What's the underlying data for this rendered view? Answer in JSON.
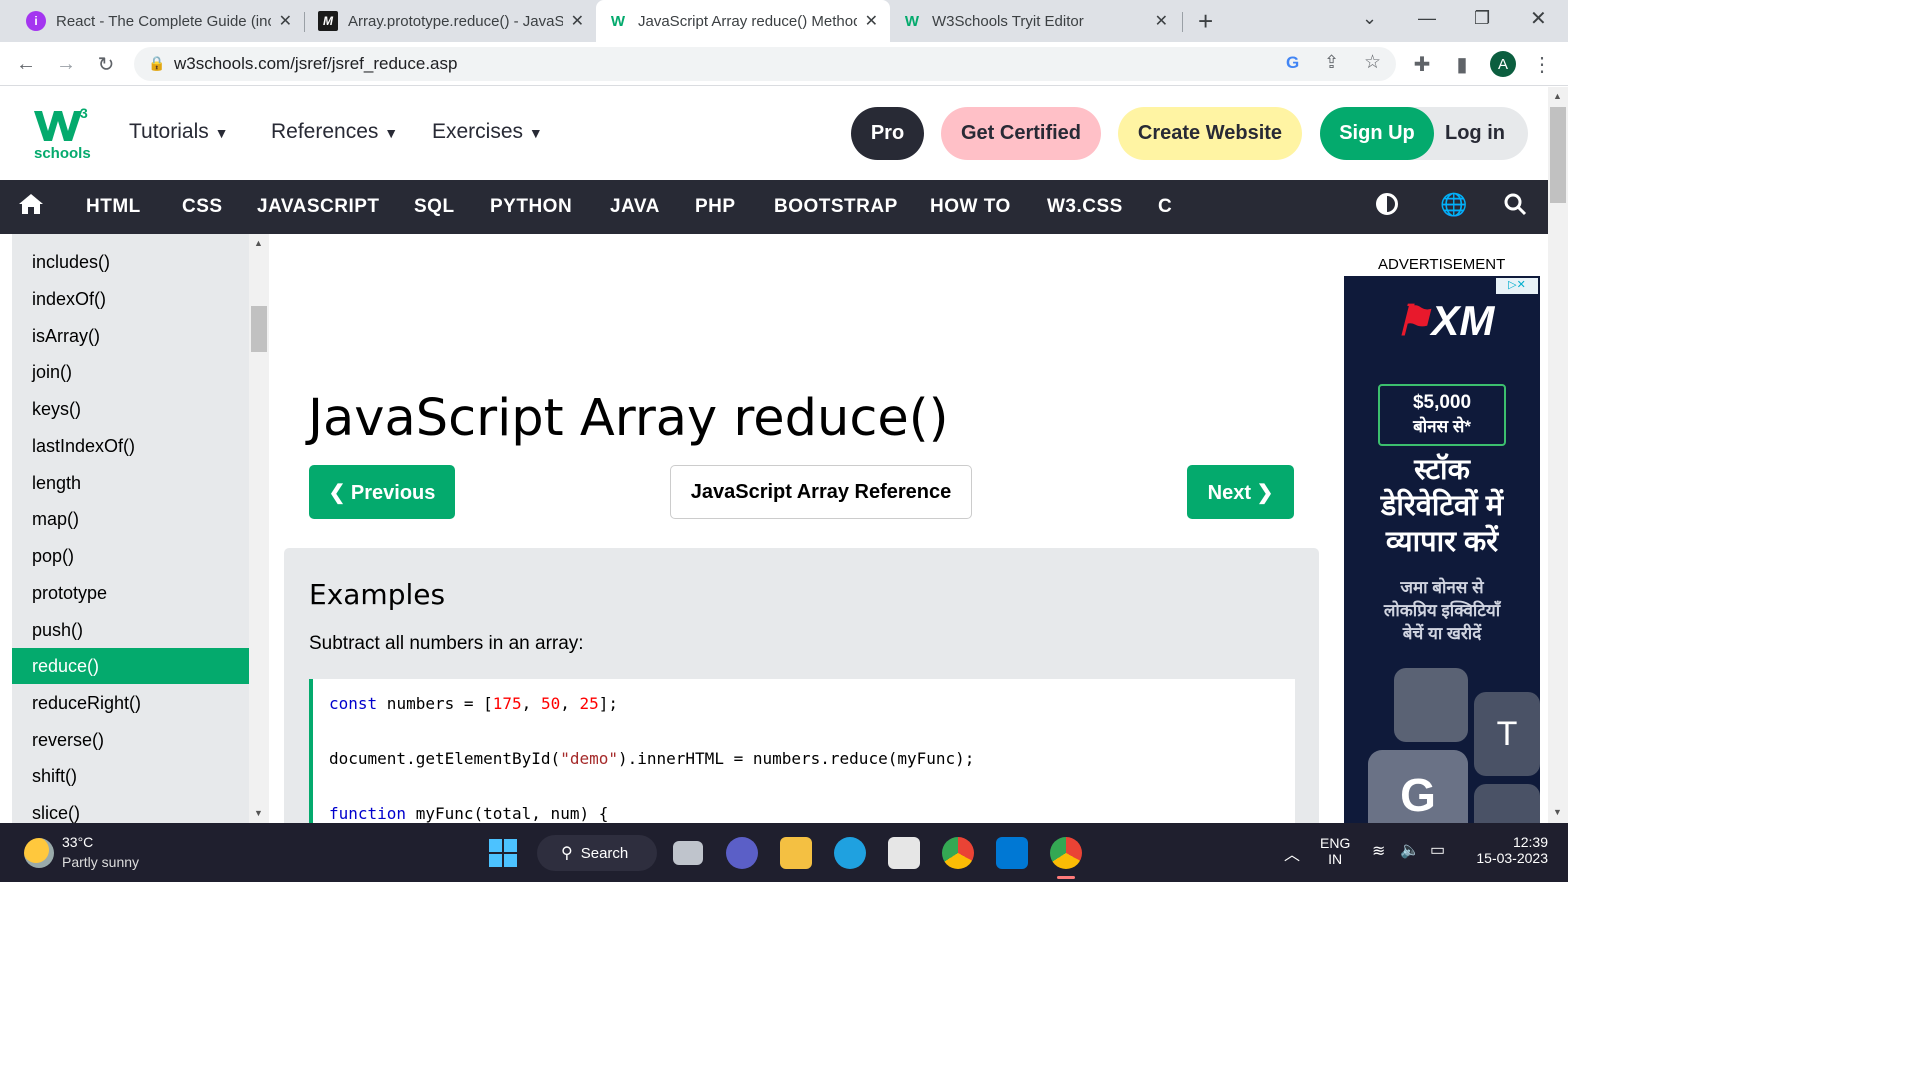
{
  "browser": {
    "tabs": [
      {
        "title": "React - The Complete Guide (incl",
        "icon": "udemy-icon",
        "color": "#a435f0"
      },
      {
        "title": "Array.prototype.reduce() - JavaSc",
        "icon": "mdn-icon",
        "color": "#1b1b1b"
      },
      {
        "title": "JavaScript Array reduce() Method",
        "icon": "w3schools-icon",
        "color": "#04aa6d"
      },
      {
        "title": "W3Schools Tryit Editor",
        "icon": "w3schools-icon",
        "color": "#04aa6d"
      }
    ],
    "url": "w3schools.com/jsref/jsref_reduce.asp",
    "profile_initial": "A"
  },
  "header": {
    "logo_text": "schools",
    "logo_sup": "3",
    "menus": [
      "Tutorials",
      "References",
      "Exercises"
    ],
    "pro": "Pro",
    "get_certified": "Get Certified",
    "create_website": "Create Website",
    "sign_up": "Sign Up",
    "log_in": "Log in"
  },
  "topnav": [
    "HTML",
    "CSS",
    "JAVASCRIPT",
    "SQL",
    "PYTHON",
    "JAVA",
    "PHP",
    "BOOTSTRAP",
    "HOW TO",
    "W3.CSS",
    "C"
  ],
  "sidebar": {
    "items": [
      "includes()",
      "indexOf()",
      "isArray()",
      "join()",
      "keys()",
      "lastIndexOf()",
      "length",
      "map()",
      "pop()",
      "prototype",
      "push()",
      "reduce()",
      "reduceRight()",
      "reverse()",
      "shift()",
      "slice()"
    ],
    "selected": "reduce()"
  },
  "main": {
    "title": "JavaScript Array reduce()",
    "previous": "❮ Previous",
    "reference": "JavaScript Array Reference",
    "next": "Next ❯",
    "examples_heading": "Examples",
    "examples_desc": "Subtract all numbers in an array:",
    "code": {
      "line1_kw": "const",
      "line1_a": " numbers = [",
      "n1": "175",
      "n2": "50",
      "n3": "25",
      "line1_end": "];",
      "line2_a": "document.getElementById(",
      "line2_str": "\"demo\"",
      "line2_b": ").innerHTML = numbers.reduce(myFunc);",
      "line3_kw": "function",
      "line3_a": " myFunc(total, num) {"
    }
  },
  "ad": {
    "label": "ADVERTISEMENT",
    "brand": "XM",
    "bonus_amount": "$5,000",
    "bonus_text": "बोनस से*",
    "headline1": "स्टॉक",
    "headline2": "डेरिवेटिवों में",
    "headline3": "व्यापार करें",
    "sub1": "जमा बोनस से",
    "sub2": "लोकप्रिय इक्विटियाँ",
    "sub3": "बेचें या खरीदें"
  },
  "taskbar": {
    "temp": "33°C",
    "weather": "Partly sunny",
    "search": "Search",
    "lang1": "ENG",
    "lang2": "IN",
    "time": "12:39",
    "date": "15-03-2023"
  }
}
